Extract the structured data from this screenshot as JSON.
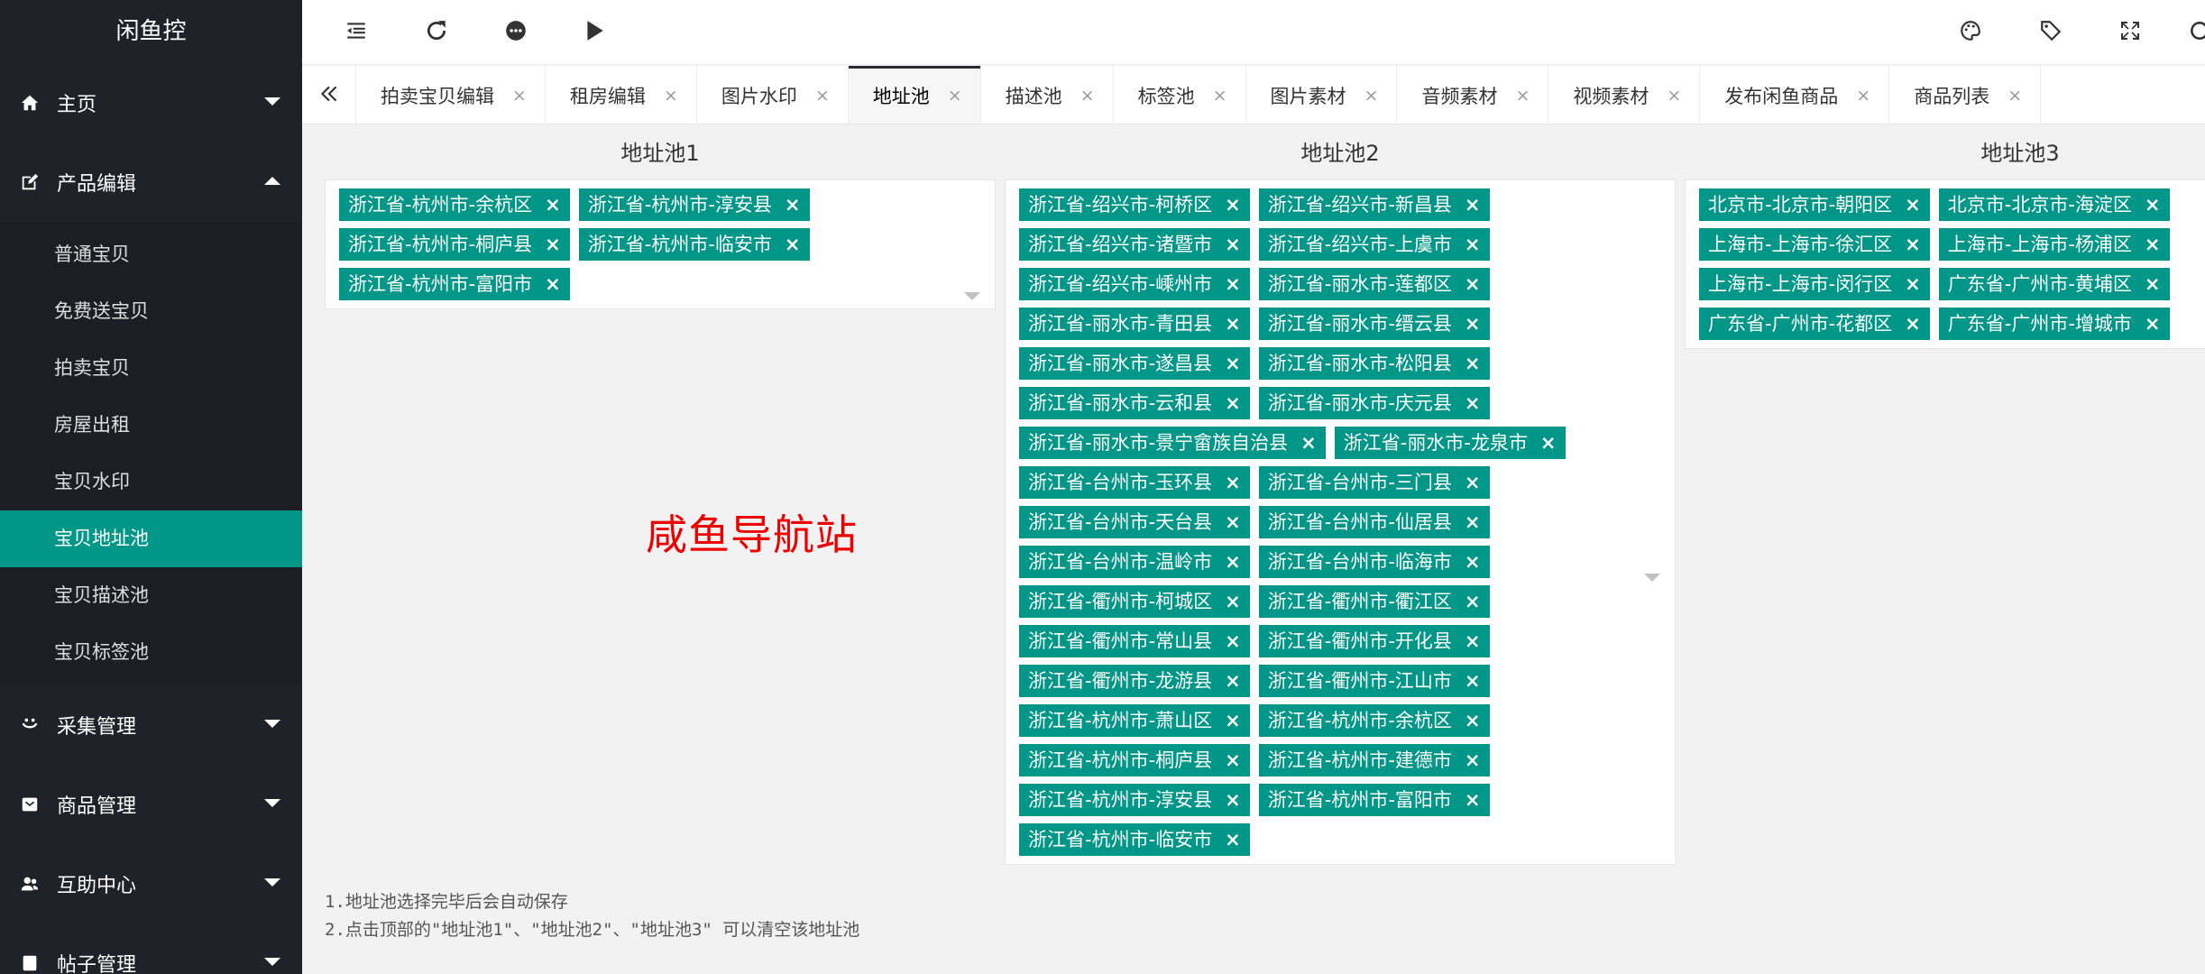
{
  "app": {
    "title": "闲鱼控"
  },
  "sidebar": {
    "menus": [
      {
        "label": "主页",
        "icon": "home-icon",
        "expanded": false
      },
      {
        "label": "产品编辑",
        "icon": "edit-icon",
        "expanded": true
      }
    ],
    "sub_items": [
      "普通宝贝",
      "免费送宝贝",
      "拍卖宝贝",
      "房屋出租",
      "宝贝水印",
      "宝贝地址池",
      "宝贝描述池",
      "宝贝标签池"
    ],
    "active_sub": "宝贝地址池",
    "menus_after": [
      {
        "label": "采集管理",
        "icon": "collect-icon"
      },
      {
        "label": "商品管理",
        "icon": "goods-icon"
      },
      {
        "label": "互助中心",
        "icon": "users-icon"
      },
      {
        "label": "帖子管理",
        "icon": "post-icon"
      }
    ]
  },
  "header": {
    "left_icons": [
      "collapse-icon",
      "refresh-icon",
      "chat-icon",
      "play-icon"
    ],
    "right_icons": [
      "theme-icon",
      "tag-icon",
      "fullscreen-icon",
      "more-icon"
    ]
  },
  "tabs": {
    "items": [
      "拍卖宝贝编辑",
      "租房编辑",
      "图片水印",
      "地址池",
      "描述池",
      "标签池",
      "图片素材",
      "音频素材",
      "视频素材",
      "发布闲鱼商品",
      "商品列表"
    ],
    "active": "地址池",
    "close_glyph": "×"
  },
  "pools": [
    {
      "title": "地址池1",
      "tags": [
        "浙江省-杭州市-余杭区",
        "浙江省-杭州市-淳安县",
        "浙江省-杭州市-桐庐县",
        "浙江省-杭州市-临安市",
        "浙江省-杭州市-富阳市"
      ]
    },
    {
      "title": "地址池2",
      "tags": [
        "浙江省-绍兴市-柯桥区",
        "浙江省-绍兴市-新昌县",
        "浙江省-绍兴市-诸暨市",
        "浙江省-绍兴市-上虞市",
        "浙江省-绍兴市-嵊州市",
        "浙江省-丽水市-莲都区",
        "浙江省-丽水市-青田县",
        "浙江省-丽水市-缙云县",
        "浙江省-丽水市-遂昌县",
        "浙江省-丽水市-松阳县",
        "浙江省-丽水市-云和县",
        "浙江省-丽水市-庆元县",
        "浙江省-丽水市-景宁畲族自治县",
        "浙江省-丽水市-龙泉市",
        "浙江省-台州市-玉环县",
        "浙江省-台州市-三门县",
        "浙江省-台州市-天台县",
        "浙江省-台州市-仙居县",
        "浙江省-台州市-温岭市",
        "浙江省-台州市-临海市",
        "浙江省-衢州市-柯城区",
        "浙江省-衢州市-衢江区",
        "浙江省-衢州市-常山县",
        "浙江省-衢州市-开化县",
        "浙江省-衢州市-龙游县",
        "浙江省-衢州市-江山市",
        "浙江省-杭州市-萧山区",
        "浙江省-杭州市-余杭区",
        "浙江省-杭州市-桐庐县",
        "浙江省-杭州市-建德市",
        "浙江省-杭州市-淳安县",
        "浙江省-杭州市-富阳市",
        "浙江省-杭州市-临安市"
      ]
    },
    {
      "title": "地址池3",
      "tags": [
        "北京市-北京市-朝阳区",
        "北京市-北京市-海淀区",
        "上海市-上海市-徐汇区",
        "上海市-上海市-杨浦区",
        "上海市-上海市-闵行区",
        "广东省-广州市-黄埔区",
        "广东省-广州市-花都区",
        "广东省-广州市-增城市"
      ]
    }
  ],
  "tag_close_glyph": "×",
  "brand_text": "咸鱼导航站",
  "notes": [
    "1.地址池选择完毕后会自动保存",
    "2.点击顶部的\"地址池1\"、\"地址池2\"、\"地址池3\" 可以清空该地址池"
  ]
}
